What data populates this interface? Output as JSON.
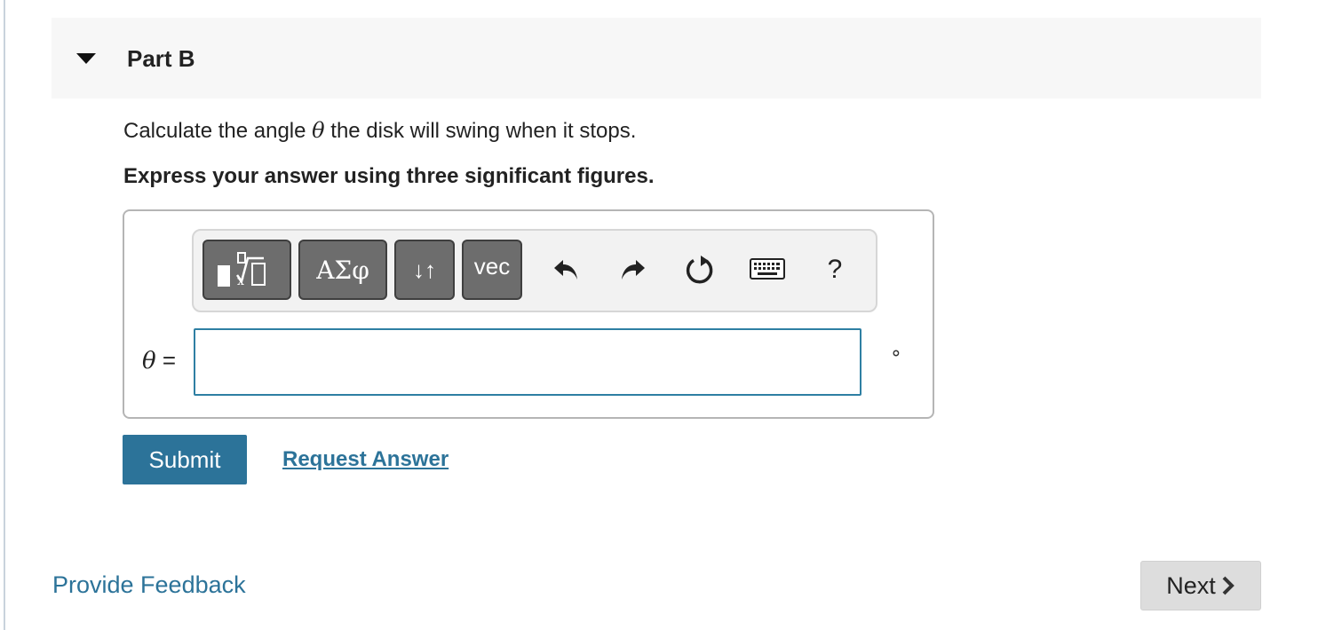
{
  "part": {
    "title": "Part B",
    "collapse_icon": "caret-down-icon"
  },
  "question": {
    "text_before": "Calculate the angle ",
    "symbol": "θ",
    "text_after": " the disk will swing when it stops.",
    "instruction": "Express your answer using three significant figures."
  },
  "toolbar": {
    "template_icon": "templates-icon",
    "greek_label": "ΑΣφ",
    "arrows_label": "↓↑",
    "vec_label": "vec",
    "undo_icon": "undo-icon",
    "redo_icon": "redo-icon",
    "reset_icon": "reset-icon",
    "keyboard_icon": "keyboard-icon",
    "help_label": "?"
  },
  "answer": {
    "variable": "θ",
    "equals": " =",
    "value": "",
    "unit": "∘"
  },
  "actions": {
    "submit_label": "Submit",
    "request_label": "Request Answer"
  },
  "footer": {
    "feedback_label": "Provide Feedback",
    "next_label": "Next"
  },
  "colors": {
    "accent": "#2c7399",
    "toolbar_button": "#6d6d6d",
    "header_bg": "#f7f7f7"
  }
}
